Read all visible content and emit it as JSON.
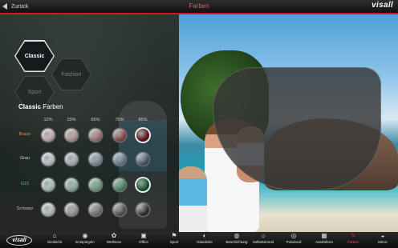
{
  "topbar": {
    "back_label": "Zurück",
    "title": "Farben",
    "brand": "visall"
  },
  "categories": [
    {
      "label": "Classic",
      "selected": true
    },
    {
      "label": "Fashion",
      "selected": false
    },
    {
      "label": "Sport",
      "selected": false
    }
  ],
  "colors_section": {
    "title_bold": "Classic",
    "title_rest": " Farben",
    "tint_levels": [
      "12%",
      "25%",
      "65%",
      "75%",
      "85%"
    ],
    "rows": [
      {
        "label": "Braun",
        "label_color": "#e08a5e",
        "swatches": [
          "#f3d5d2",
          "#e0b6b3",
          "#c98b89",
          "#a55454",
          "#7a1717"
        ],
        "selected": 4
      },
      {
        "label": "Grau",
        "label_color": "#d9d9d9",
        "swatches": [
          "#f2f2f6",
          "#d9dbe6",
          "#a6adc3",
          "#8a93ac",
          "#5c6482"
        ],
        "selected": null
      },
      {
        "label": "G15",
        "label_color": "#4fbf6a",
        "swatches": [
          "#d7eedd",
          "#b3d8bf",
          "#8dbfa0",
          "#5d9c74",
          "#1f6b38"
        ],
        "selected": 4
      },
      {
        "label": "Schwarz",
        "label_color": "#bdbdbd",
        "swatches": [
          "#dce8df",
          "#b7b7b7",
          "#8a8a8a",
          "#5d5d5d",
          "#2f2f2f"
        ],
        "selected": null
      }
    ]
  },
  "toolbar": {
    "logo": "visall",
    "items": [
      {
        "label": "Gleitsicht",
        "icon": "⌂",
        "active": false
      },
      {
        "label": "Entspiegeln",
        "icon": "◉",
        "active": false
      },
      {
        "label": "Wellness",
        "icon": "✿",
        "active": false
      },
      {
        "label": "Office",
        "icon": "▣",
        "active": false
      },
      {
        "label": "Sport",
        "icon": "⚑",
        "active": false
      },
      {
        "label": "Glasdicke",
        "icon": "◐",
        "active": false
      },
      {
        "label": "Beschichtung",
        "icon": "◍",
        "active": false
      },
      {
        "label": "Selbsttönend",
        "icon": "☼",
        "active": false
      },
      {
        "label": "Polarised",
        "icon": "◎",
        "active": false
      },
      {
        "label": "Autofahren",
        "icon": "▦",
        "active": false
      },
      {
        "label": "Farben",
        "icon": "✎",
        "active": true
      },
      {
        "label": "Mirror",
        "icon": "◒",
        "active": false
      }
    ]
  },
  "colors": {
    "accent": "#d8132b",
    "title": "#e35a6c"
  }
}
